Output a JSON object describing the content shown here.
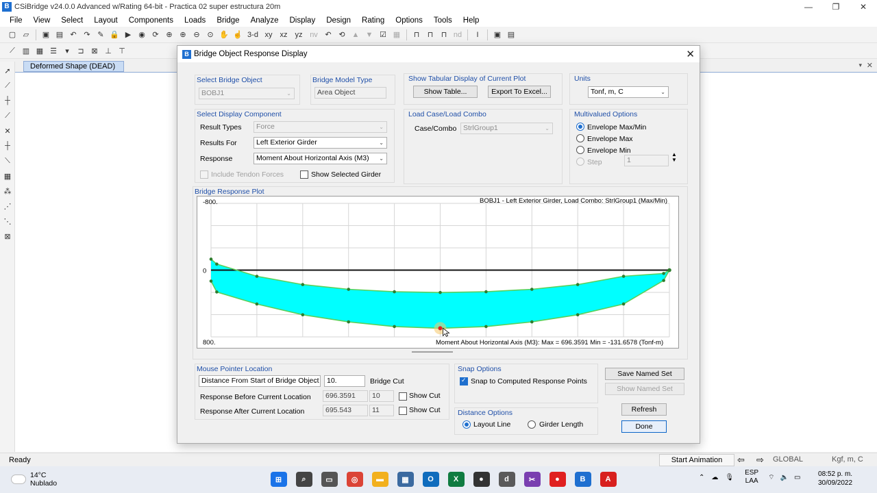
{
  "app": {
    "title": "CSiBridge v24.0.0 Advanced w/Rating 64-bit - Practica 02 super estructura 20m",
    "icon_letter": "B",
    "window_buttons": [
      "—",
      "❐",
      "✕"
    ]
  },
  "menu": [
    "File",
    "View",
    "Select",
    "Layout",
    "Components",
    "Loads",
    "Bridge",
    "Analyze",
    "Display",
    "Design",
    "Rating",
    "Options",
    "Tools",
    "Help"
  ],
  "toolbar1": [
    "new-icon",
    "open-icon",
    "save-icon",
    "save-as-icon",
    "undo-icon",
    "redo-icon",
    "pencil-icon",
    "lock-icon",
    "run-icon",
    "run-analysis-icon",
    "refresh-icon",
    "zoom-window-icon",
    "zoom-in-icon",
    "zoom-out-icon",
    "zoom-all-icon",
    "pan-icon",
    "pointer-icon"
  ],
  "toolbar1_views": [
    "3-d",
    "xy",
    "xz",
    "yz",
    "nv"
  ],
  "toolbar1_more": [
    "↶",
    "⟲",
    "▲",
    "▼",
    "☑",
    "▦",
    "⊓",
    "⊓",
    "⊓",
    "nd",
    "I",
    "▣",
    "▤"
  ],
  "document": {
    "tab_label": "Deformed Shape (DEAD)",
    "close": "✕",
    "dropdown": "▾"
  },
  "status": {
    "ready": "Ready",
    "start_animation": "Start Animation",
    "prev": "⇦",
    "next": "⇨",
    "coord_system": "GLOBAL",
    "units": "Kgf, m, C"
  },
  "taskbar": {
    "temperature": "14°C",
    "weather": "Nublado",
    "lang1": "ESP",
    "lang2": "LAA",
    "time": "08:52 p. m.",
    "date": "30/09/2022",
    "apps": [
      {
        "name": "start-icon",
        "glyph": "⊞",
        "color": "#1a73e8"
      },
      {
        "name": "search-icon",
        "glyph": "⌕",
        "color": "#444"
      },
      {
        "name": "taskview-icon",
        "glyph": "▭",
        "color": "#555"
      },
      {
        "name": "chrome-icon",
        "glyph": "◎",
        "color": "#db4437"
      },
      {
        "name": "folder-icon",
        "glyph": "▬",
        "color": "#f2b01e"
      },
      {
        "name": "calculator-icon",
        "glyph": "▦",
        "color": "#3b6aa0"
      },
      {
        "name": "outlook-icon",
        "glyph": "O",
        "color": "#0f6cbd"
      },
      {
        "name": "excel-icon",
        "glyph": "X",
        "color": "#107c41"
      },
      {
        "name": "app-dark-icon",
        "glyph": "●",
        "color": "#333"
      },
      {
        "name": "app-d-icon",
        "glyph": "d",
        "color": "#5a5a5a"
      },
      {
        "name": "snipping-icon",
        "glyph": "✂",
        "color": "#7a3fb0"
      },
      {
        "name": "recorder-icon",
        "glyph": "●",
        "color": "#e02020"
      },
      {
        "name": "csibridge-icon",
        "glyph": "B",
        "color": "#1e6fd0"
      },
      {
        "name": "acrobat-icon",
        "glyph": "A",
        "color": "#d8201e"
      }
    ]
  },
  "dialog": {
    "title": "Bridge Object Response Display",
    "close": "✕",
    "select_bridge_object": {
      "title": "Select Bridge Object",
      "value": "BOBJ1"
    },
    "bridge_model_type": {
      "title": "Bridge Model Type",
      "value": "Area Object"
    },
    "tabular": {
      "title": "Show Tabular Display of Current Plot",
      "show_table": "Show Table...",
      "export": "Export To Excel..."
    },
    "units": {
      "title": "Units",
      "value": "Tonf, m, C"
    },
    "display_component": {
      "title": "Select Display Component",
      "result_types_label": "Result Types",
      "result_types_value": "Force",
      "results_for_label": "Results For",
      "results_for_value": "Left Exterior Girder",
      "response_label": "Response",
      "response_value": "Moment About Horizontal Axis  (M3)",
      "include_tendon": "Include Tendon Forces",
      "show_selected_girder": "Show Selected Girder"
    },
    "load_case": {
      "title": "Load Case/Load Combo",
      "label": "Case/Combo",
      "value": "StrlGroup1"
    },
    "multivalued": {
      "title": "Multivalued Options",
      "options": [
        "Envelope Max/Min",
        "Envelope Max",
        "Envelope Min",
        "Step"
      ],
      "selected": "Envelope Max/Min",
      "step_value": "1"
    },
    "plot": {
      "title": "Bridge Response Plot",
      "header": "BOBJ1 - Left Exterior Girder,  Load Combo: StrlGroup1 (Max/Min)",
      "footer": "Moment About Horizontal Axis  (M3):  Max = 696.3591    Min = -131.6578   (Tonf-m)",
      "y_top": "-800.",
      "y_zero": "0",
      "y_bottom": "800."
    },
    "mouse_location": {
      "title": "Mouse Pointer Location",
      "mode": "Distance From Start of Bridge Object",
      "distance": "10.",
      "bridge_cut": "Bridge Cut",
      "before_label": "Response Before Current Location",
      "before_value": "696.3591",
      "before_cut": "10",
      "after_label": "Response After Current Location",
      "after_value": "695.543",
      "after_cut": "11",
      "show_cut": "Show Cut"
    },
    "snap": {
      "title": "Snap Options",
      "label": "Snap to Computed Response Points",
      "checked": true
    },
    "distance_options": {
      "title": "Distance Options",
      "layout_line": "Layout Line",
      "girder_length": "Girder Length",
      "selected": "Layout Line"
    },
    "buttons": {
      "save_named": "Save Named Set",
      "show_named": "Show Named Set",
      "refresh": "Refresh",
      "done": "Done"
    }
  },
  "chart_data": {
    "type": "area",
    "title": "BOBJ1 - Left Exterior Girder,  Load Combo: StrlGroup1 (Max/Min)",
    "xlabel": "",
    "ylabel": "Moment About Horizontal Axis  (M3)",
    "y_reversed": true,
    "ylim": [
      -800,
      800
    ],
    "xlim": [
      0,
      20
    ],
    "grid": true,
    "x": [
      0,
      0.25,
      2,
      4,
      6,
      8,
      10,
      12,
      14,
      16,
      18,
      19.75,
      20
    ],
    "series": [
      {
        "name": "Max",
        "color": "#5ad05a",
        "values": [
          131.6578,
          262,
          406,
          535,
          620,
          676,
          696.3591,
          676,
          620,
          535,
          406,
          124,
          0
        ]
      },
      {
        "name": "Min",
        "color": "#5ad05a",
        "values": [
          -131.6578,
          -72,
          74,
          173,
          230,
          259,
          268,
          259,
          230,
          173,
          74,
          40,
          0
        ]
      }
    ],
    "fill": "#00ffff",
    "highlight": {
      "x": 10,
      "value": 696.3591,
      "color": "#e02020"
    }
  }
}
